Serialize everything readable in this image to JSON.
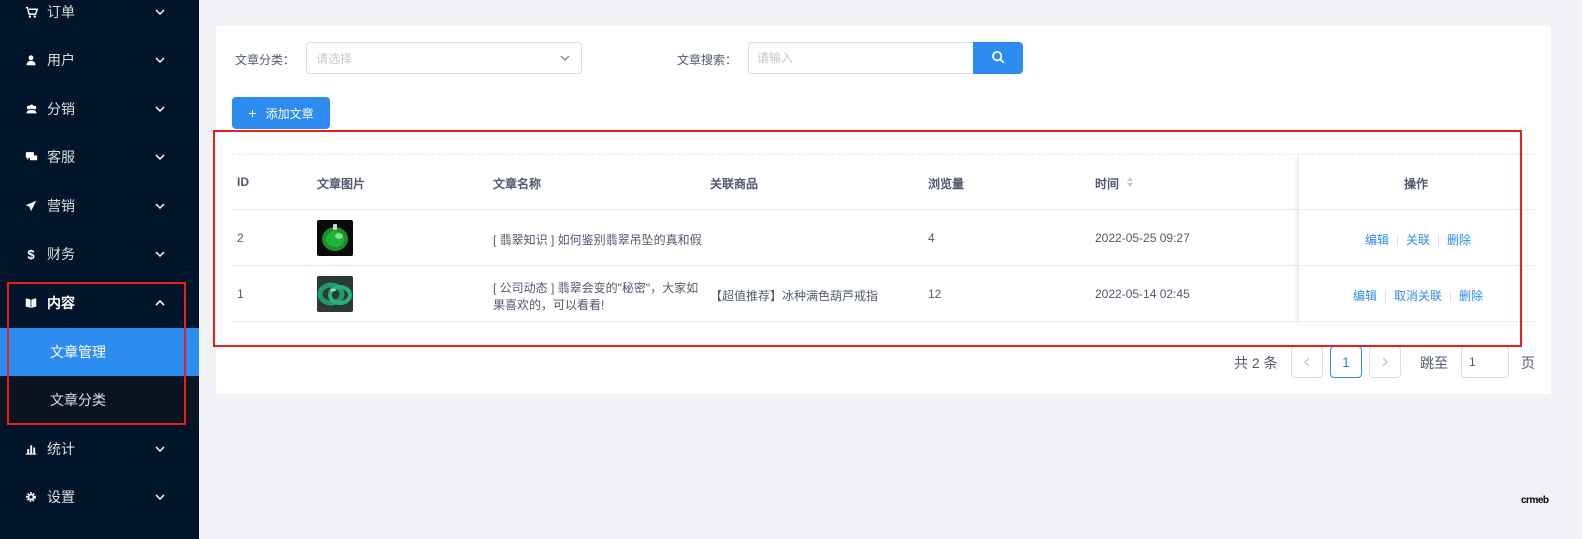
{
  "sidebar": {
    "items": [
      {
        "label": "订单",
        "icon": "cart-icon"
      },
      {
        "label": "用户",
        "icon": "user-icon"
      },
      {
        "label": "分销",
        "icon": "team-icon"
      },
      {
        "label": "客服",
        "icon": "chat-icon"
      },
      {
        "label": "营销",
        "icon": "send-icon"
      },
      {
        "label": "财务",
        "icon": "dollar-icon"
      },
      {
        "label": "内容",
        "icon": "book-icon"
      },
      {
        "label": "统计",
        "icon": "bar-chart-icon"
      },
      {
        "label": "设置",
        "icon": "gear-icon"
      }
    ],
    "submenu": [
      {
        "label": "文章管理",
        "active": true
      },
      {
        "label": "文章分类",
        "active": false
      }
    ]
  },
  "filters": {
    "category_label": "文章分类：",
    "category_placeholder": "请选择",
    "search_label": "文章搜索：",
    "search_placeholder": "请输入"
  },
  "toolbar": {
    "add_label": "添加文章"
  },
  "table": {
    "headers": {
      "id": "ID",
      "image": "文章图片",
      "title": "文章名称",
      "product": "关联商品",
      "views": "浏览量",
      "time": "时间",
      "actions": "操作"
    },
    "rows": [
      {
        "id": "2",
        "title_line1": "[ 翡翠知识 ] 如何鉴别翡翠吊坠的真和假",
        "title_line2": "",
        "product": "",
        "views": "4",
        "time": "2022-05-25 09:27",
        "actions": [
          "编辑",
          "关联",
          "删除"
        ]
      },
      {
        "id": "1",
        "title_line1": "[ 公司动态 ] 翡翠会变的\"秘密\"，大家如",
        "title_line2": "果喜欢的，可以看看!",
        "product": "【超值推荐】冰种满色葫芦戒指",
        "views": "12",
        "time": "2022-05-14 02:45",
        "actions": [
          "编辑",
          "取消关联",
          "删除"
        ]
      }
    ]
  },
  "pagination": {
    "total": "共 2 条",
    "current_page": "1",
    "jump_label": "跳至",
    "jump_value": "1",
    "page_suffix": "页"
  },
  "brand": {
    "logo_text": "crmeb"
  },
  "colors": {
    "sidebar_bg": "#001529",
    "accent": "#2d8cf0",
    "highlight_red": "#e8201b"
  }
}
